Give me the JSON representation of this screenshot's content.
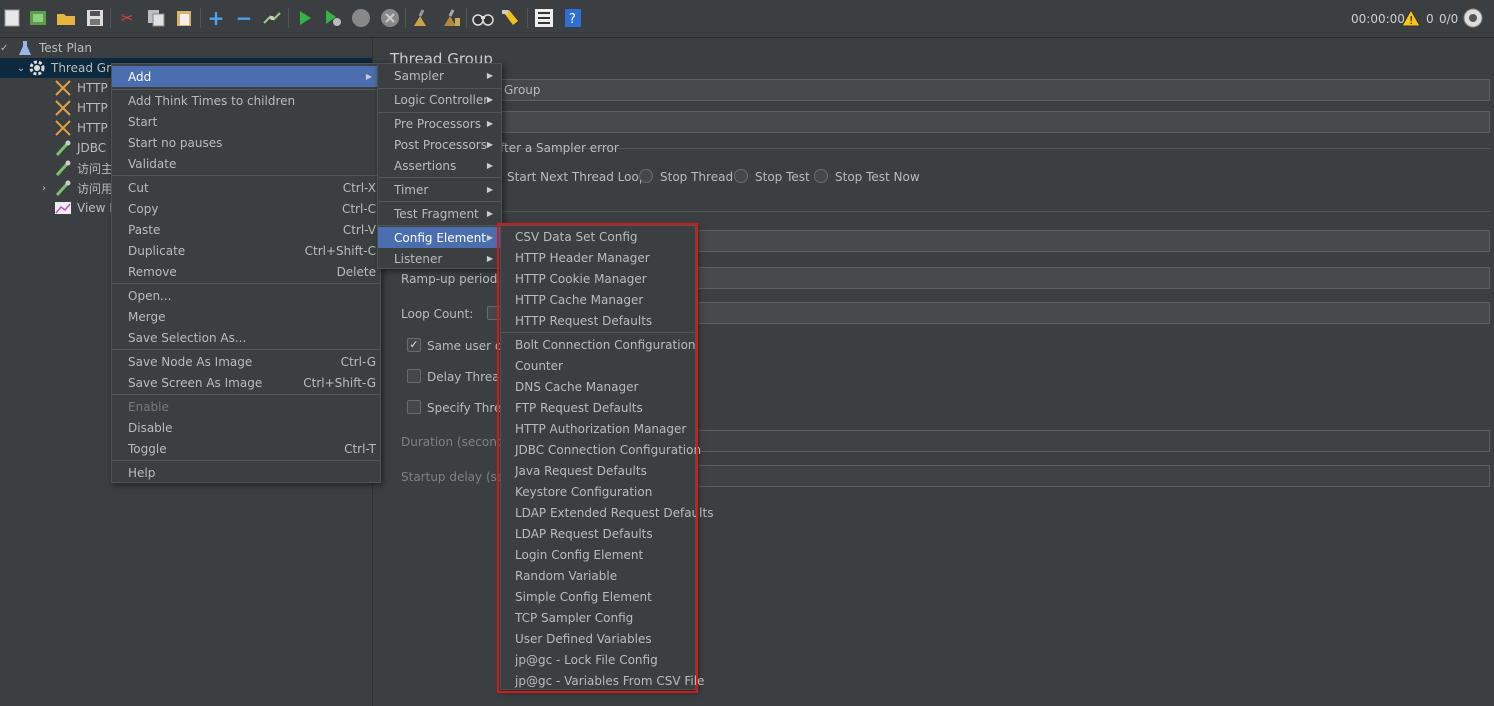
{
  "toolbar": {
    "icons": [
      "new-icon",
      "templates-icon",
      "open-icon",
      "save-icon",
      "cut-icon",
      "copy-icon",
      "paste-icon",
      "expand-icon",
      "collapse-icon",
      "toggle-icon",
      "start-icon",
      "start-no-pauses-icon",
      "stop-icon",
      "shutdown-icon",
      "clear-icon",
      "clear-all-icon",
      "search-icon",
      "reset-search-icon",
      "function-helper-icon",
      "help-icon"
    ],
    "timer": "00:00:00",
    "warnings": "0",
    "threads": "0/0"
  },
  "tree": {
    "items": [
      {
        "label": "Test Plan",
        "icon": "flask-icon"
      },
      {
        "label": "Thread Gro",
        "icon": "gear-icon"
      },
      {
        "label": "HTTP (",
        "icon": "sampler-icon"
      },
      {
        "label": "HTTP (",
        "icon": "sampler-icon"
      },
      {
        "label": "HTTP F",
        "icon": "sampler-icon"
      },
      {
        "label": "JDBC F",
        "icon": "pipette-icon"
      },
      {
        "label": "访问主",
        "icon": "pipette-icon"
      },
      {
        "label": "访问用",
        "icon": "pipette-icon"
      },
      {
        "label": "View R",
        "icon": "chart-icon"
      }
    ]
  },
  "panel": {
    "title": "Thread Group",
    "name_value": "Group",
    "sampler_error_label": "fter a Sampler error",
    "radio_options": [
      "Start Next Thread Loop",
      "Stop Thread",
      "Stop Test",
      "Stop Test Now"
    ],
    "rampup_label": "Ramp-up period (s",
    "loop_count_label": "Loop Count:",
    "same_user_label": "Same user on",
    "delay_thread_label": "Delay Thread",
    "specify_thread_label": "Specify Threa",
    "duration_label": "Duration (seconds",
    "startup_delay_label": "Startup delay (seco"
  },
  "context_menu": {
    "items": [
      {
        "label": "Add",
        "accel": "",
        "submenu": true
      },
      {
        "label": "Add Think Times to children",
        "accel": ""
      },
      {
        "label": "Start",
        "accel": ""
      },
      {
        "label": "Start no pauses",
        "accel": ""
      },
      {
        "label": "Validate",
        "accel": ""
      },
      {
        "label": "Cut",
        "accel": "Ctrl-X"
      },
      {
        "label": "Copy",
        "accel": "Ctrl-C"
      },
      {
        "label": "Paste",
        "accel": "Ctrl-V"
      },
      {
        "label": "Duplicate",
        "accel": "Ctrl+Shift-C"
      },
      {
        "label": "Remove",
        "accel": "Delete"
      },
      {
        "label": "Open...",
        "accel": ""
      },
      {
        "label": "Merge",
        "accel": ""
      },
      {
        "label": "Save Selection As...",
        "accel": ""
      },
      {
        "label": "Save Node As Image",
        "accel": "Ctrl-G"
      },
      {
        "label": "Save Screen As Image",
        "accel": "Ctrl+Shift-G"
      },
      {
        "label": "Enable",
        "accel": ""
      },
      {
        "label": "Disable",
        "accel": ""
      },
      {
        "label": "Toggle",
        "accel": "Ctrl-T"
      },
      {
        "label": "Help",
        "accel": ""
      }
    ]
  },
  "add_submenu": {
    "items": [
      "Sampler",
      "Logic Controller",
      "Pre Processors",
      "Post Processors",
      "Assertions",
      "Timer",
      "Test Fragment",
      "Config Element",
      "Listener"
    ]
  },
  "config_submenu": {
    "items": [
      "CSV Data Set Config",
      "HTTP Header Manager",
      "HTTP Cookie Manager",
      "HTTP Cache Manager",
      "HTTP Request Defaults",
      "Bolt Connection Configuration",
      "Counter",
      "DNS Cache Manager",
      "FTP Request Defaults",
      "HTTP Authorization Manager",
      "JDBC Connection Configuration",
      "Java Request Defaults",
      "Keystore Configuration",
      "LDAP Extended Request Defaults",
      "LDAP Request Defaults",
      "Login Config Element",
      "Random Variable",
      "Simple Config Element",
      "TCP Sampler Config",
      "User Defined Variables",
      "jp@gc - Lock File Config",
      "jp@gc - Variables From CSV File"
    ]
  },
  "colors": {
    "background": "#3c3f41",
    "menu_selected": "#4b6eaf",
    "highlight_border": "#d11a1a"
  }
}
